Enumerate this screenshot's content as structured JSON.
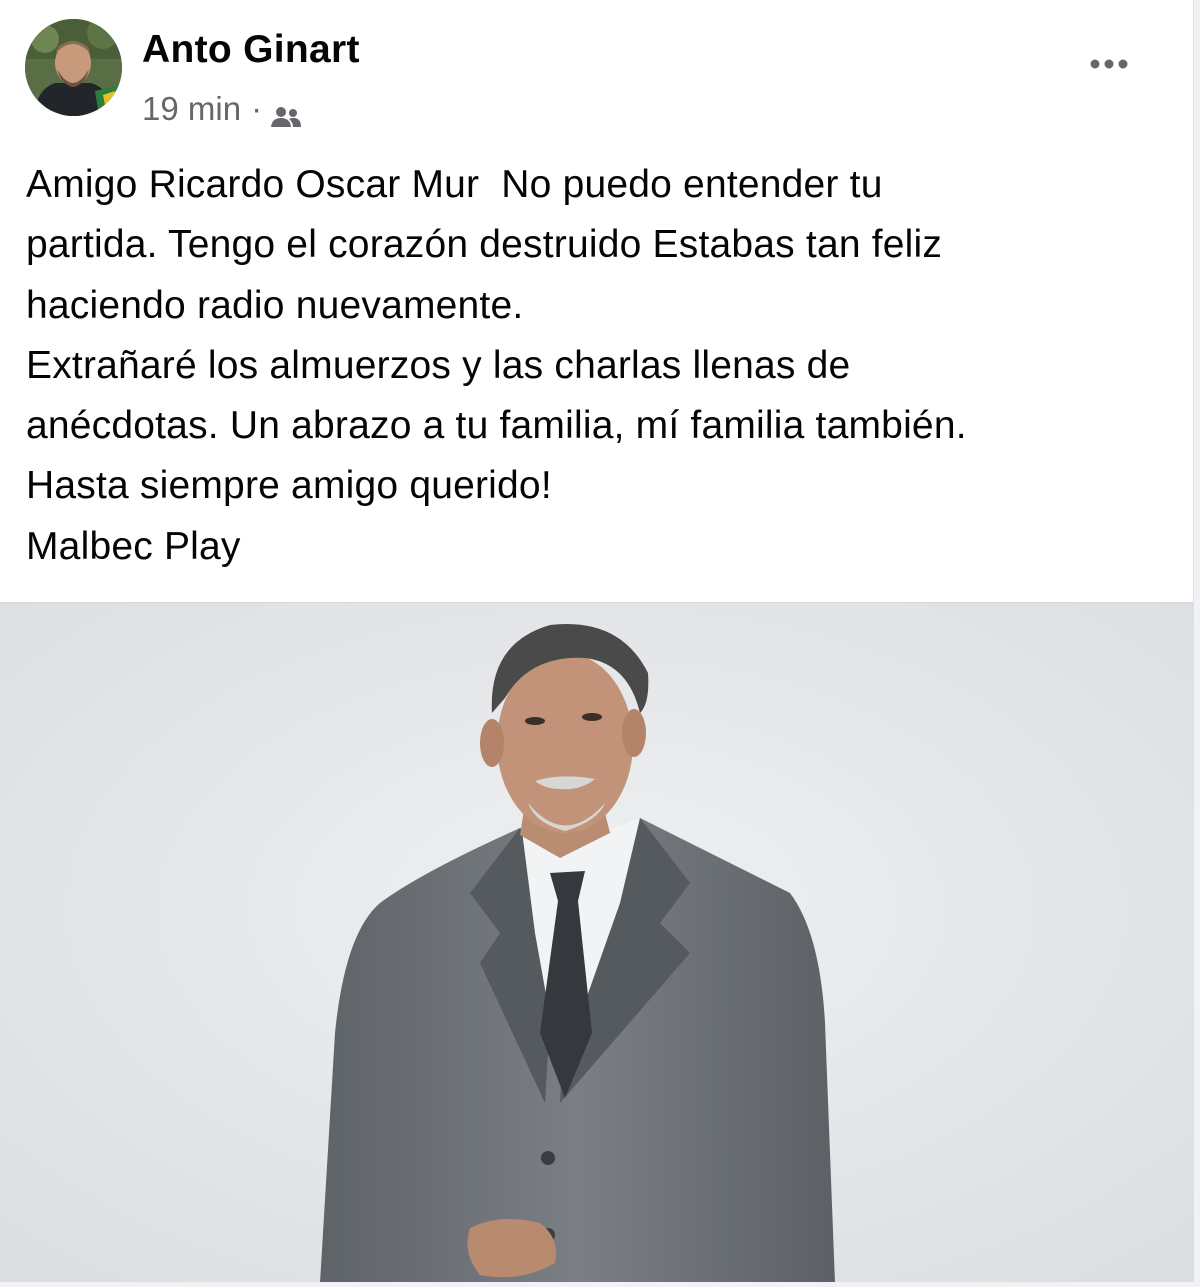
{
  "post": {
    "author": "Anto Ginart",
    "time": "19 min",
    "separator": "·",
    "audience_icon": "friends-icon",
    "more_icon": "more-options-icon",
    "text_lines": [
      "Amigo Ricardo Oscar Mur  No puedo entender tu",
      "partida. Tengo el corazón destruido Estabas tan feliz",
      "haciendo radio nuevamente.",
      "Extrañaré los almuerzos y las charlas llenas de",
      "anécdotas. Un abrazo a tu familia, mí familia también.",
      "Hasta siempre amigo querido!",
      "Malbec Play"
    ]
  },
  "colors": {
    "text": "#050505",
    "secondary_text": "#65676b",
    "suit": "#6f7479",
    "tie": "#3a3d42",
    "background": "#e6e8eb"
  }
}
